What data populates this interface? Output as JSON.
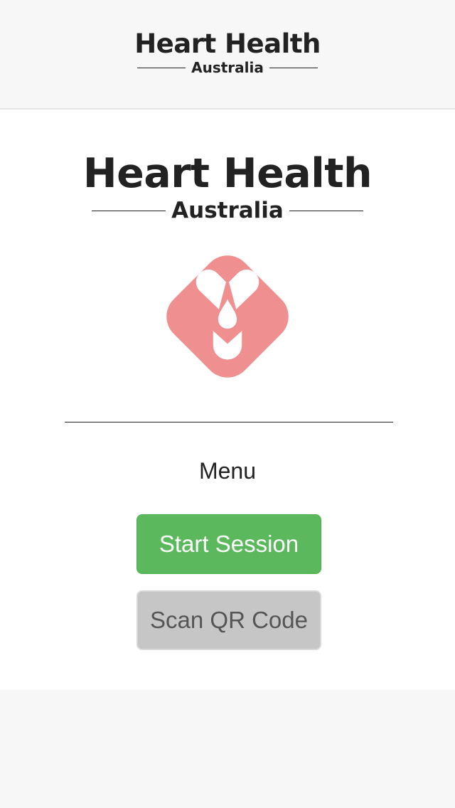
{
  "header": {
    "brand_title": "Heart Health",
    "brand_subtitle": "Australia"
  },
  "main": {
    "brand_title": "Heart Health",
    "brand_subtitle": "Australia",
    "logo_icon": "heart-health-logo-icon",
    "menu_label": "Menu",
    "start_button_label": "Start Session",
    "scan_button_label": "Scan QR Code"
  },
  "colors": {
    "logo_pink": "#f08f8f",
    "start_green": "#5cb85c",
    "scan_gray": "#c6c6c6",
    "background": "#f7f7f7"
  }
}
